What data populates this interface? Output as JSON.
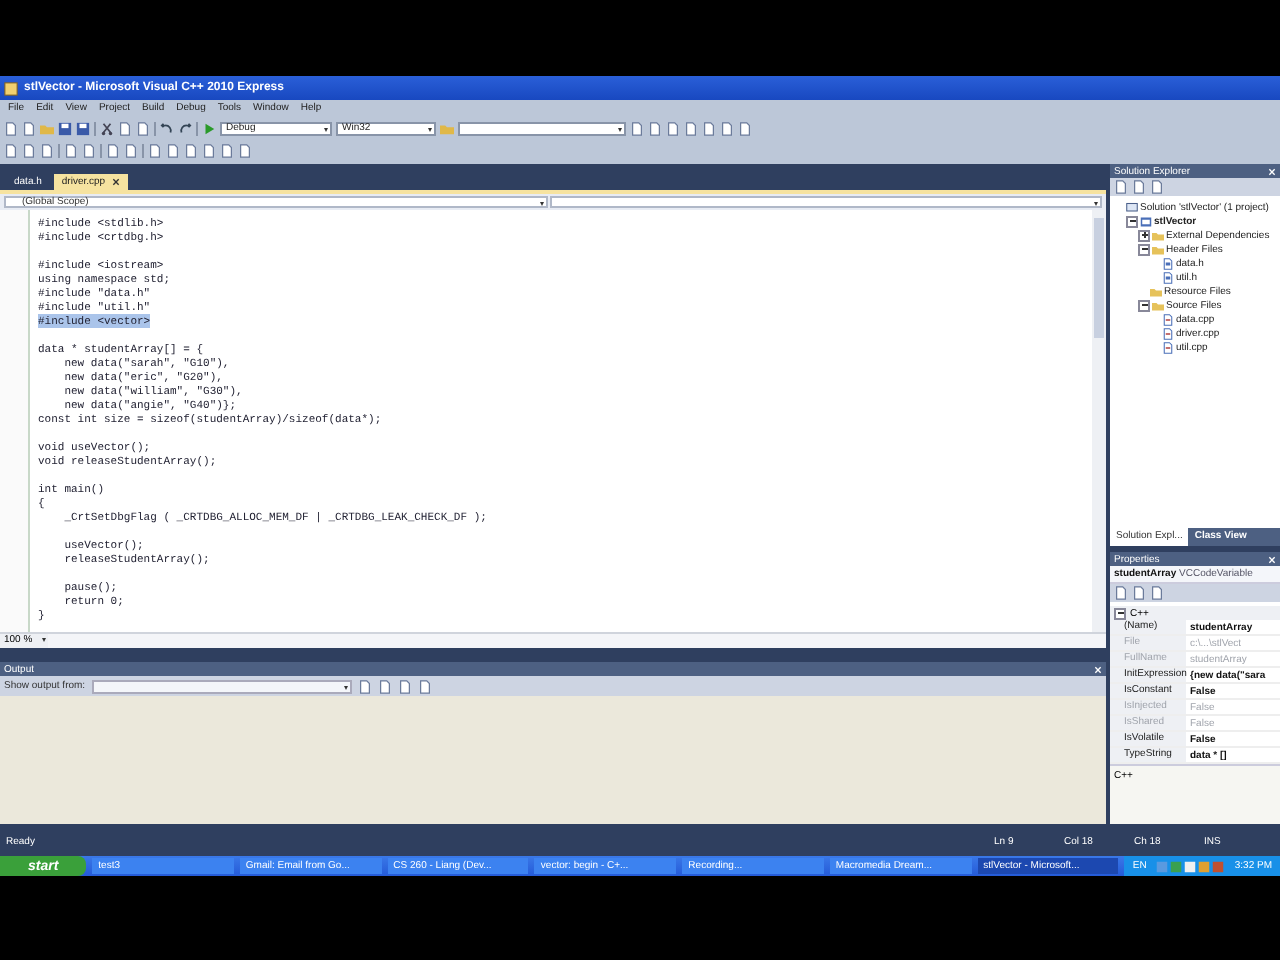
{
  "window": {
    "title": "stlVector - Microsoft Visual C++ 2010 Express"
  },
  "menu": [
    "File",
    "Edit",
    "View",
    "Project",
    "Build",
    "Debug",
    "Tools",
    "Window",
    "Help"
  ],
  "toolbar": {
    "configuration": "Debug",
    "platform": "Win32"
  },
  "document_tabs": [
    {
      "label": "data.h",
      "selected": false
    },
    {
      "label": "driver.cpp",
      "selected": true
    }
  ],
  "scope": "(Global Scope)",
  "code_blocks": [
    [
      {
        "text": "#include <stdlib.h>",
        "selected": false
      },
      {
        "text": "#include <crtdbg.h>",
        "selected": false
      }
    ],
    [
      {
        "text": "#include <iostream>",
        "selected": false
      },
      {
        "text": "using namespace std;",
        "selected": false
      },
      {
        "text": "#include \"data.h\"",
        "selected": false
      },
      {
        "text": "#include \"util.h\"",
        "selected": false
      },
      {
        "text": "#include <vector>",
        "selected": true
      }
    ],
    [
      {
        "text": "data * studentArray[] = {",
        "selected": false
      },
      {
        "text": "    new data(\"sarah\", \"G10\"),",
        "selected": false
      },
      {
        "text": "    new data(\"eric\", \"G20\"),",
        "selected": false
      },
      {
        "text": "    new data(\"william\", \"G30\"),",
        "selected": false
      },
      {
        "text": "    new data(\"angie\", \"G40\")};",
        "selected": false
      },
      {
        "text": "const int size = sizeof(studentArray)/sizeof(data*);",
        "selected": false
      }
    ],
    [
      {
        "text": "void useVector();",
        "selected": false
      },
      {
        "text": "void releaseStudentArray();",
        "selected": false
      }
    ],
    [
      {
        "text": "int main()",
        "selected": false
      },
      {
        "text": "{",
        "selected": false
      },
      {
        "text": "    _CrtSetDbgFlag ( _CRTDBG_ALLOC_MEM_DF | _CRTDBG_LEAK_CHECK_DF );",
        "selected": false
      }
    ],
    [
      {
        "text": "    useVector();",
        "selected": false
      },
      {
        "text": "    releaseStudentArray();",
        "selected": false
      }
    ],
    [
      {
        "text": "    pause();",
        "selected": false
      },
      {
        "text": "    return 0;",
        "selected": false
      },
      {
        "text": "}",
        "selected": false
      }
    ]
  ],
  "zoom": "100 %",
  "output": {
    "title": "Output",
    "show_output_from": "Show output from:"
  },
  "solution_explorer": {
    "title": "Solution Explorer",
    "tree": [
      {
        "label": "Solution 'stlVector' (1 project)",
        "kind": "solution",
        "children": [
          {
            "label": "stlVector",
            "kind": "project",
            "expanded": true,
            "children": [
              {
                "label": "External Dependencies",
                "kind": "folder",
                "expanded": false
              },
              {
                "label": "Header Files",
                "kind": "folder",
                "expanded": true,
                "children": [
                  {
                    "label": "data.h",
                    "kind": "header"
                  },
                  {
                    "label": "util.h",
                    "kind": "header"
                  }
                ]
              },
              {
                "label": "Resource Files",
                "kind": "folder"
              },
              {
                "label": "Source Files",
                "kind": "folder",
                "expanded": true,
                "children": [
                  {
                    "label": "data.cpp",
                    "kind": "source"
                  },
                  {
                    "label": "driver.cpp",
                    "kind": "source"
                  },
                  {
                    "label": "util.cpp",
                    "kind": "source"
                  }
                ]
              }
            ]
          }
        ]
      }
    ],
    "tabs": [
      {
        "label": "Solution Expl...",
        "selected": true
      },
      {
        "label": "Class View",
        "selected": false
      }
    ]
  },
  "properties": {
    "title": "Properties",
    "object_name": "studentArray",
    "object_type": "VCCodeVariable",
    "category": "C++",
    "rows": [
      {
        "name": "(Name)",
        "value": "studentArray",
        "disabled": false
      },
      {
        "name": "File",
        "value": "c:\\...\\stlVect",
        "disabled": true
      },
      {
        "name": "FullName",
        "value": "studentArray",
        "disabled": true
      },
      {
        "name": "InitExpression",
        "value": "{new data(\"sara",
        "disabled": false
      },
      {
        "name": "IsConstant",
        "value": "False",
        "disabled": false
      },
      {
        "name": "IsInjected",
        "value": "False",
        "disabled": true
      },
      {
        "name": "IsShared",
        "value": "False",
        "disabled": true
      },
      {
        "name": "IsVolatile",
        "value": "False",
        "disabled": false
      },
      {
        "name": "TypeString",
        "value": "data * []",
        "disabled": false
      }
    ],
    "description": "C++"
  },
  "status_bar": {
    "message": "Ready",
    "line": "Ln 9",
    "column": "Col 18",
    "char": "Ch 18",
    "mode": "INS"
  },
  "taskbar": {
    "start": "start",
    "items": [
      {
        "label": "test3",
        "selected": false
      },
      {
        "label": "Gmail: Email from Go...",
        "selected": false
      },
      {
        "label": "CS 260 - Liang (Dev...",
        "selected": false
      },
      {
        "label": "vector: begin - C+...",
        "selected": false
      },
      {
        "label": "Recording...",
        "selected": false
      },
      {
        "label": "Macromedia Dream...",
        "selected": false
      },
      {
        "label": "stlVector - Microsoft...",
        "selected": true
      }
    ],
    "language": "EN",
    "time": "3:32 PM"
  }
}
